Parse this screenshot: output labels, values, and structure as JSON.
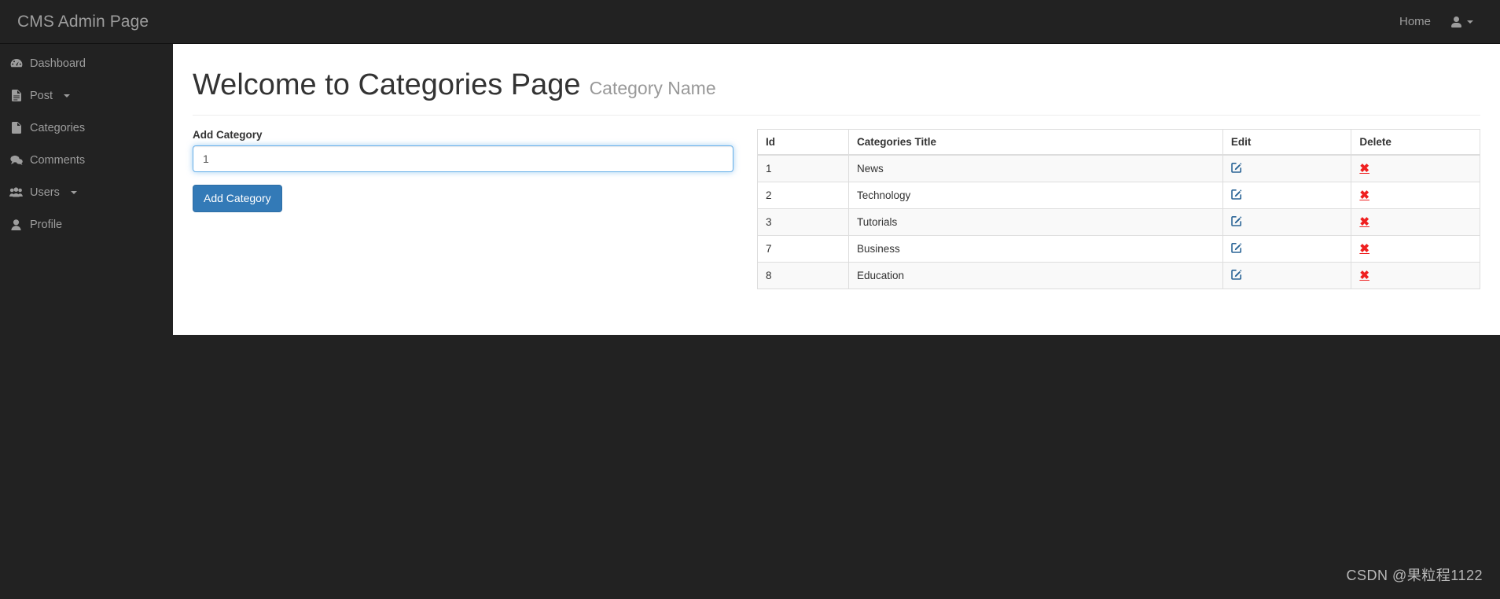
{
  "navbar": {
    "brand": "CMS Admin Page",
    "home_label": "Home",
    "user_icon": "user-icon",
    "caret_icon": "caret-down-icon"
  },
  "sidebar": {
    "items": [
      {
        "label": "Dashboard",
        "icon": "dashboard-icon",
        "caret": false
      },
      {
        "label": "Post",
        "icon": "file-text-icon",
        "caret": true
      },
      {
        "label": "Categories",
        "icon": "file-icon",
        "caret": false
      },
      {
        "label": "Comments",
        "icon": "comments-icon",
        "caret": false
      },
      {
        "label": "Users",
        "icon": "users-icon",
        "caret": true
      },
      {
        "label": "Profile",
        "icon": "user-icon",
        "caret": false
      }
    ]
  },
  "page": {
    "title": "Welcome to Categories Page",
    "subtitle": "Category Name"
  },
  "form": {
    "label": "Add Category",
    "input_value": "1",
    "input_placeholder": "",
    "submit_label": "Add Category"
  },
  "table": {
    "headers": {
      "id": "Id",
      "title": "Categories Title",
      "edit": "Edit",
      "delete": "Delete"
    },
    "edit_icon": "edit-square-icon",
    "delete_icon": "times-icon",
    "delete_glyph": "✖",
    "rows": [
      {
        "id": "1",
        "title": "News"
      },
      {
        "id": "2",
        "title": "Technology"
      },
      {
        "id": "3",
        "title": "Tutorials"
      },
      {
        "id": "7",
        "title": "Business"
      },
      {
        "id": "8",
        "title": "Education"
      }
    ]
  },
  "watermark": "CSDN @果粒程1122",
  "colors": {
    "dark_chrome": "#222222",
    "nav_text": "#9d9d9d",
    "primary": "#337ab7",
    "focus_border": "#66afe9",
    "delete_red": "#ef2020",
    "panel": "#ffffff"
  }
}
